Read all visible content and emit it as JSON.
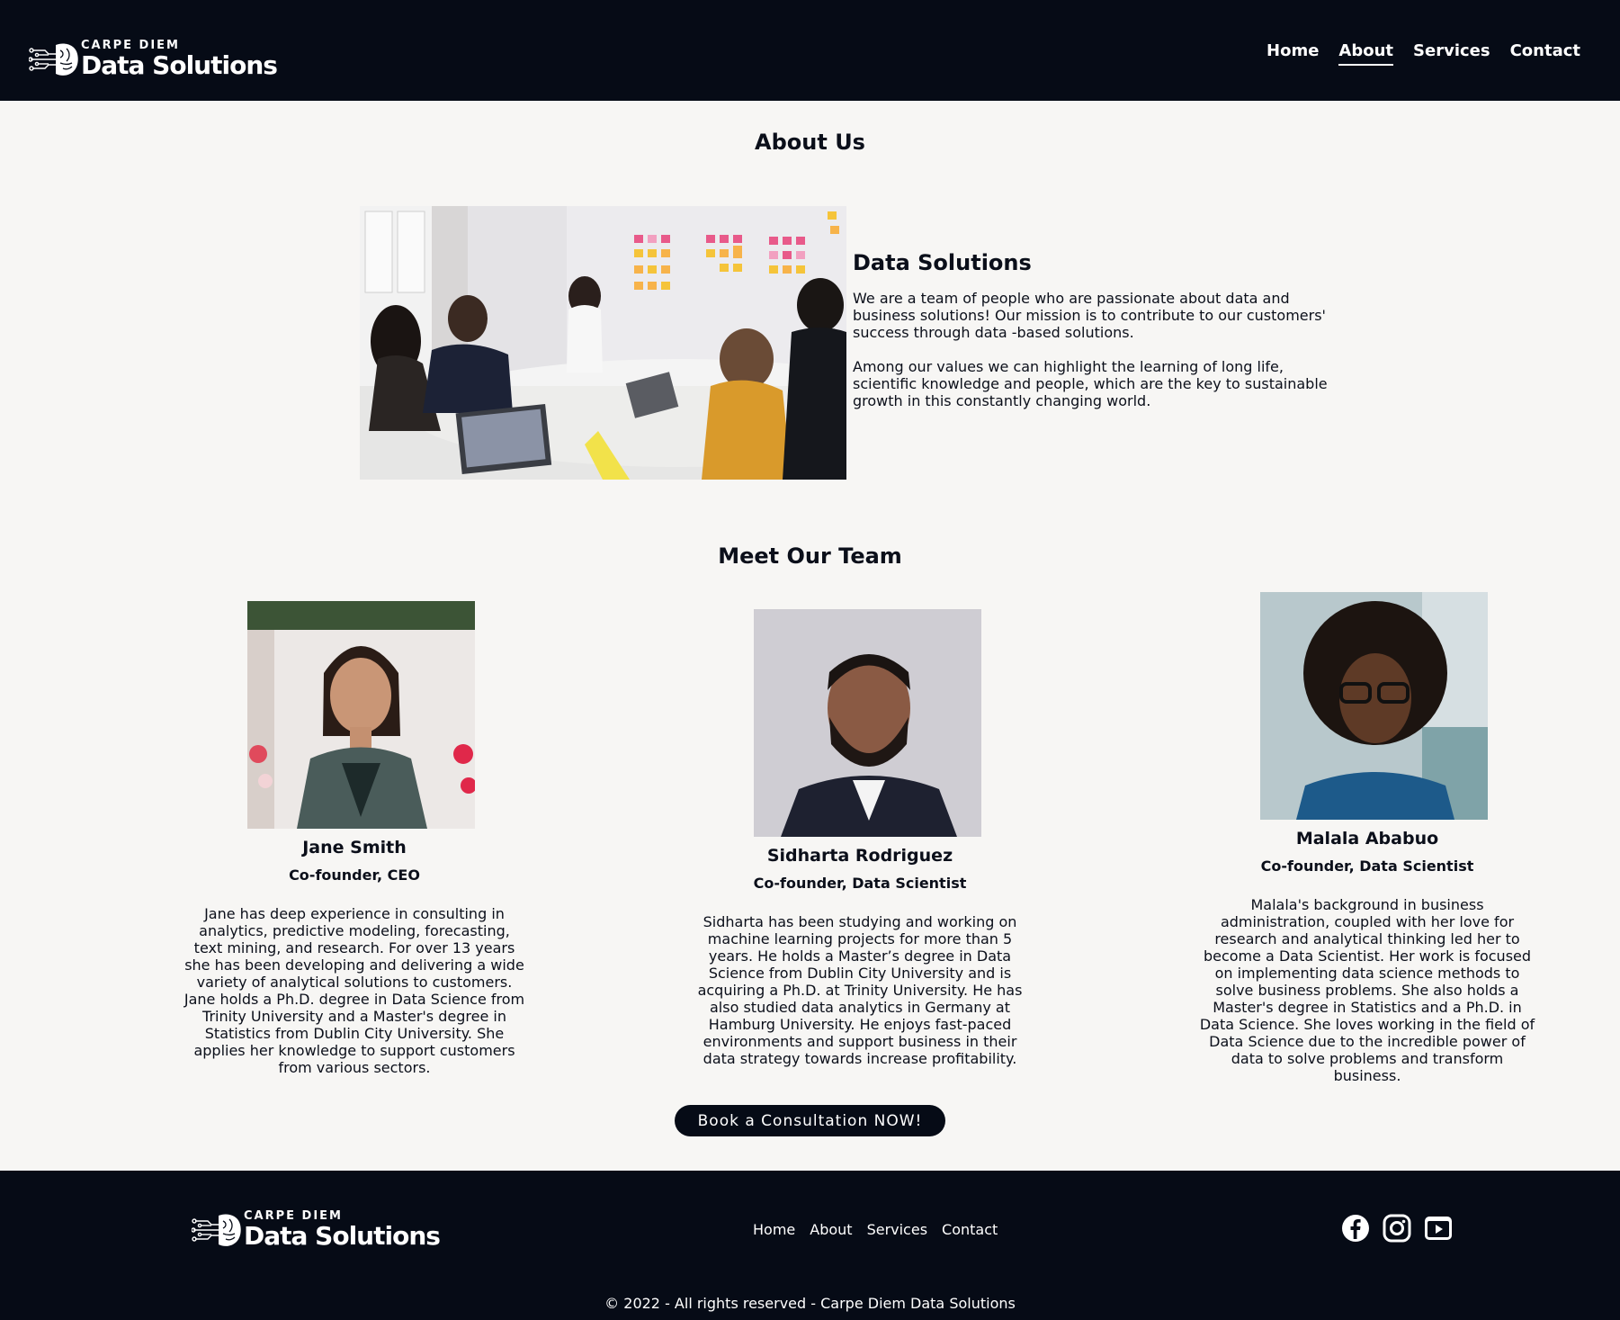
{
  "header": {
    "logo_small": "CARPE DIEM",
    "logo_big": "Data Solutions",
    "nav": [
      {
        "label": "Home"
      },
      {
        "label": "About"
      },
      {
        "label": "Services"
      },
      {
        "label": "Contact"
      }
    ],
    "active_nav": "About"
  },
  "about": {
    "title": "About Us",
    "image_icon": "team-meeting-photo",
    "heading": "Data Solutions",
    "paragraphs": [
      "We are a team of people who are passionate about data and business solutions! Our mission is to contribute to our customers' success through data -based solutions.",
      "Among our values we can highlight the learning of long life, scientific knowledge and people, which are the key to sustainable growth in this constantly changing world."
    ]
  },
  "team": {
    "title": "Meet Our Team",
    "members": [
      {
        "name": "Jane Smith",
        "role": "Co-founder, CEO",
        "bio": "Jane has deep experience in consulting in analytics, predictive modeling, forecasting, text mining, and research. For over 13 years she has been developing and delivering a wide variety of analytical solutions to customers. Jane holds a Ph.D. degree in Data Science from Trinity University and a Master's degree in Statistics from Dublin City University. She applies her knowledge to support customers from various sectors."
      },
      {
        "name": "Sidharta Rodriguez",
        "role": "Co-founder, Data Scientist",
        "bio": "Sidharta has been studying and working on machine learning projects for more than 5 years. He holds a Master’s degree in Data Science from Dublin City University and is acquiring a Ph.D. at Trinity University. He has also studied data analytics in Germany at Hamburg University. He enjoys fast-paced environments and support business in their data strategy towards increase profitability."
      },
      {
        "name": "Malala Ababuo",
        "role": "Co-founder, Data Scientist",
        "bio": "Malala's background in business administration, coupled with her love for research and analytical thinking led her to become a Data Scientist. Her work is focused on implementing data science methods to solve business problems. She also holds a Master's degree in Statistics and a Ph.D. in Data Science. She loves working in the field of Data Science due to the incredible power of data to solve problems and transform business."
      }
    ]
  },
  "cta": {
    "label": "Book a Consultation NOW!"
  },
  "footer": {
    "logo_small": "CARPE DIEM",
    "logo_big": "Data Solutions",
    "nav": [
      {
        "label": "Home"
      },
      {
        "label": "About"
      },
      {
        "label": "Services"
      },
      {
        "label": "Contact"
      }
    ],
    "social": [
      "facebook-icon",
      "instagram-icon",
      "youtube-icon"
    ],
    "copyright": "© 2022 - All rights reserved - Carpe Diem Data Solutions"
  },
  "colors": {
    "dark": "#060b16",
    "background": "#f7f6f4"
  }
}
